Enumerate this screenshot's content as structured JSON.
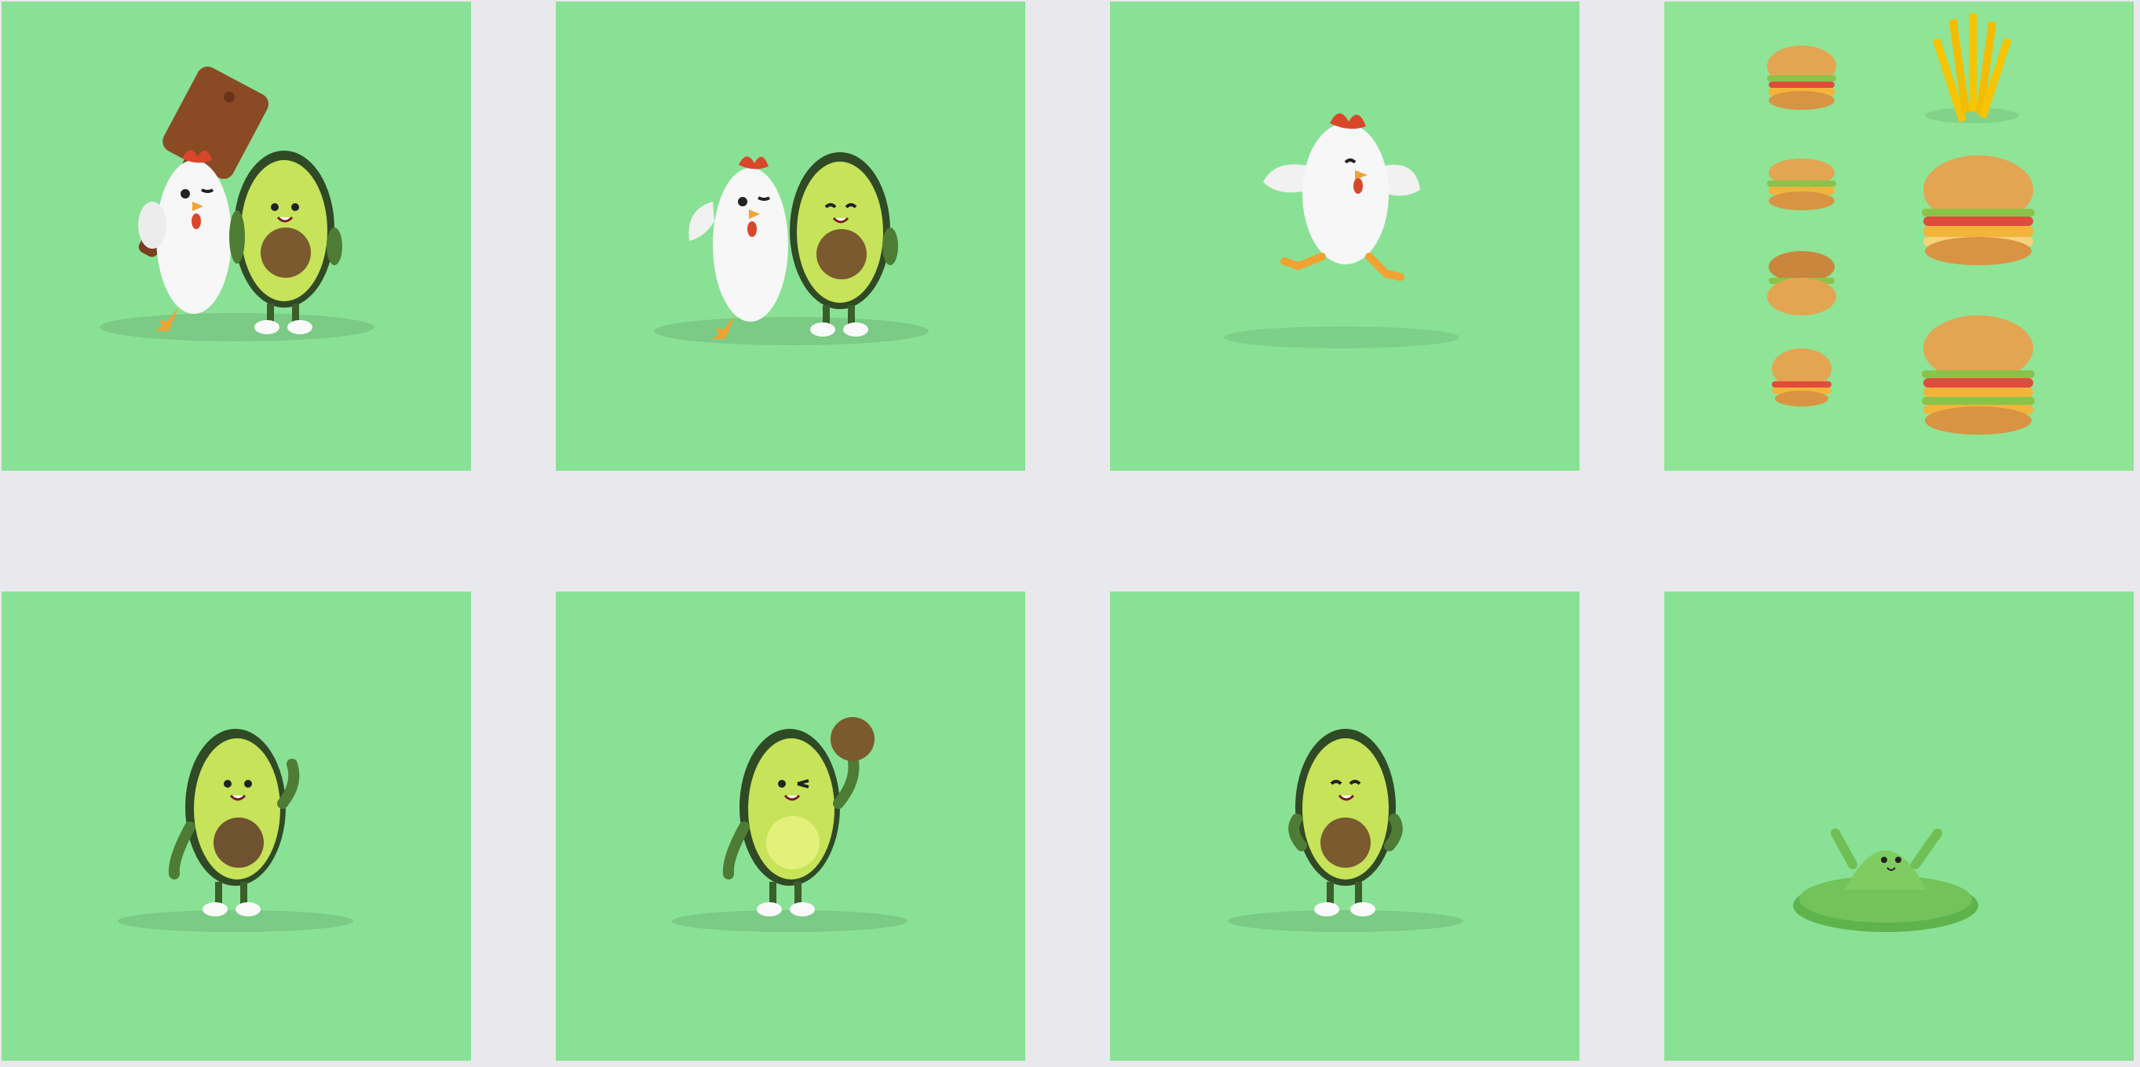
{
  "colors": {
    "page_background": "#e9e8ec",
    "tile_background": "#89e195",
    "tile_background_alt": "#8fe496",
    "avocado_skin": "#2f4a25",
    "avocado_flesh": "#c6e35a",
    "avocado_pit": "#7a5a2e",
    "chicken_body": "#f7f7f7",
    "chicken_comb": "#d9472b",
    "chicken_feet": "#f2a233",
    "bun": "#e3a552"
  },
  "gallery": {
    "tiles": [
      {
        "id": "t1",
        "subject": "chicken-and-avocado-with-cutting-board"
      },
      {
        "id": "t2",
        "subject": "chicken-and-avocado-standing"
      },
      {
        "id": "t3",
        "subject": "chicken-jumping"
      },
      {
        "id": "t4",
        "subject": "burgers-and-fries-set"
      },
      {
        "id": "t5",
        "subject": "avocado-waving"
      },
      {
        "id": "t6",
        "subject": "avocado-winking-with-pit"
      },
      {
        "id": "t7",
        "subject": "avocado-hands-on-hips"
      },
      {
        "id": "t8",
        "subject": "avocado-melted-puddle"
      }
    ]
  }
}
